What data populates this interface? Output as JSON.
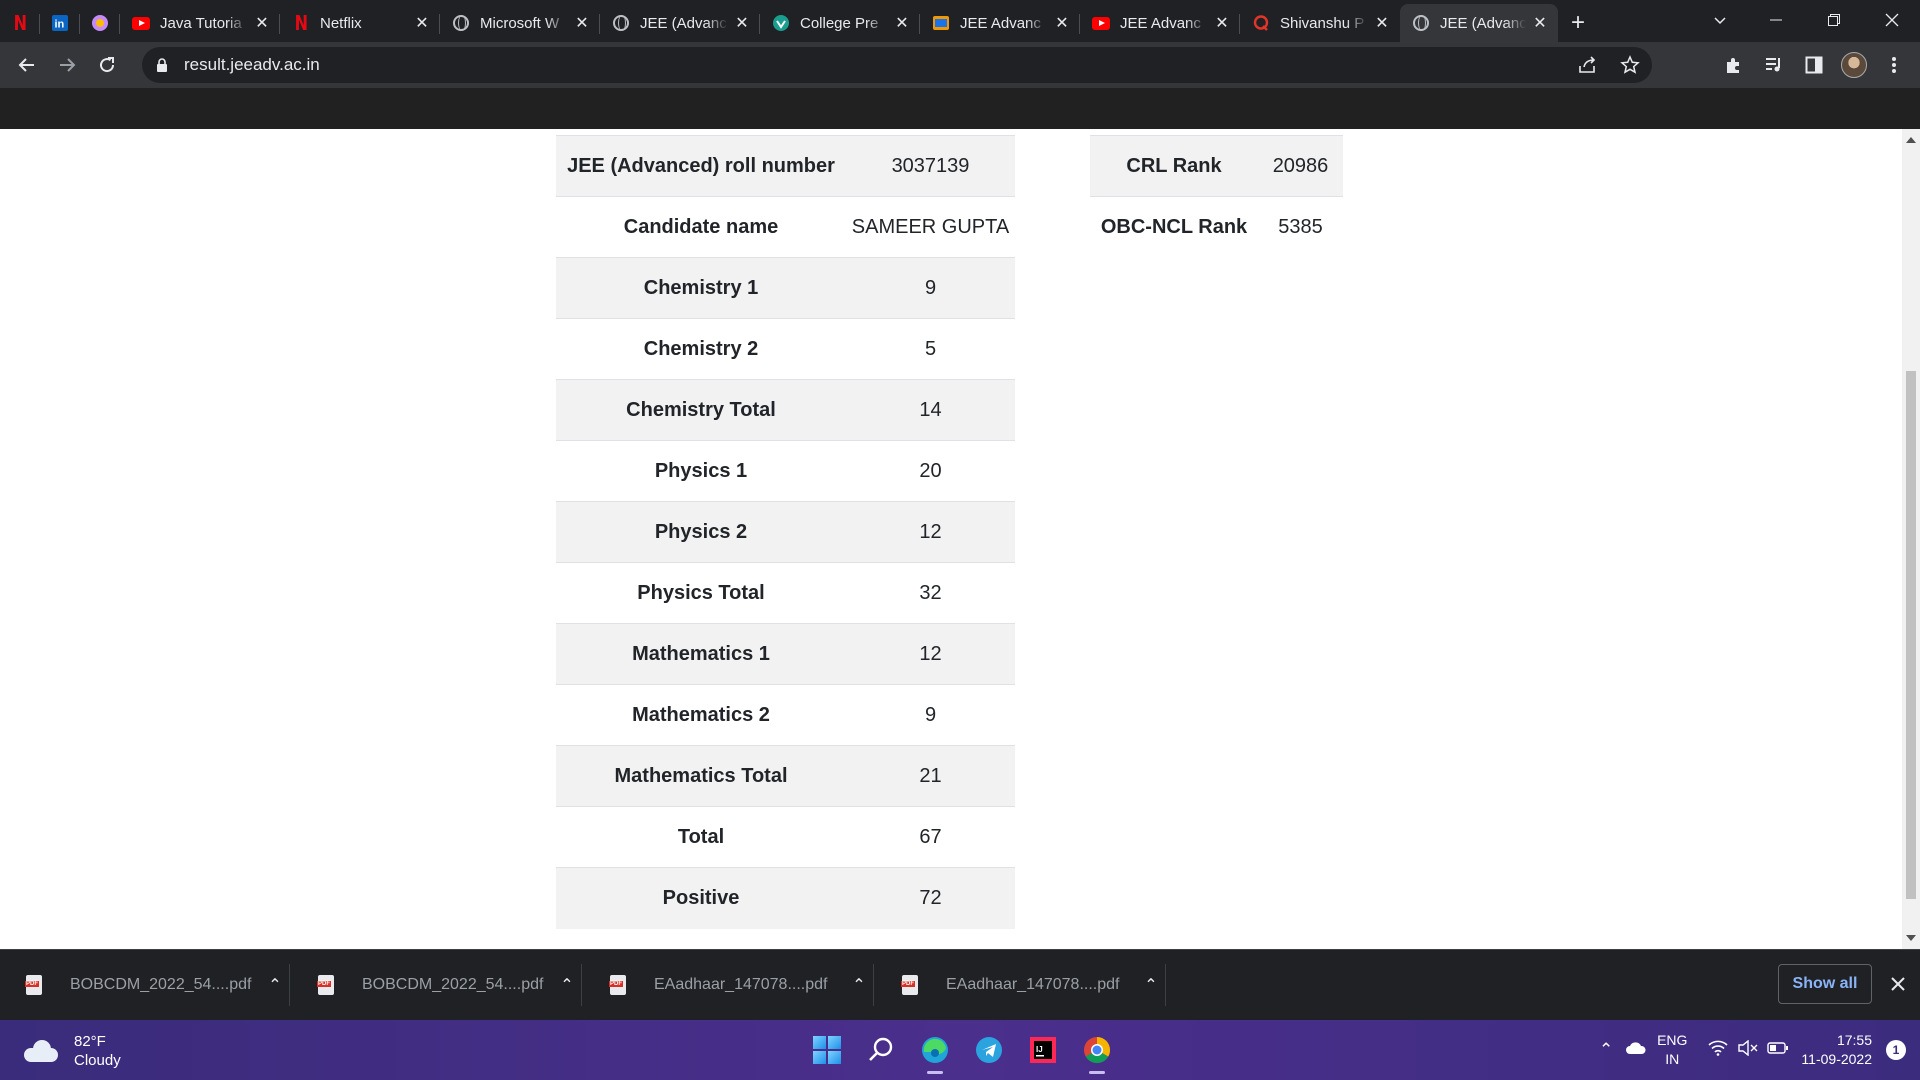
{
  "browser": {
    "tabs": [
      {
        "title": "",
        "icon": "netflix-icon",
        "pinned": true
      },
      {
        "title": "",
        "icon": "linkedin-icon",
        "pinned": true
      },
      {
        "title": "",
        "icon": "app-icon",
        "pinned": true
      },
      {
        "title": "Java Tutoria",
        "icon": "youtube-icon"
      },
      {
        "title": "Netflix",
        "icon": "netflix-icon"
      },
      {
        "title": "Microsoft W",
        "icon": "globe-icon"
      },
      {
        "title": "JEE (Advanc",
        "icon": "globe-icon"
      },
      {
        "title": "College Pre",
        "icon": "college-icon"
      },
      {
        "title": "JEE Advanc",
        "icon": "jee-icon"
      },
      {
        "title": "JEE Advanc",
        "icon": "youtube-icon"
      },
      {
        "title": "Shivanshu P",
        "icon": "quora-icon"
      },
      {
        "title": "JEE (Advanc",
        "icon": "globe-icon",
        "active": true
      }
    ],
    "url": "result.jeeadv.ac.in"
  },
  "results": {
    "rows": [
      {
        "label": "JEE (Advanced) roll number",
        "value": "3037139"
      },
      {
        "label": "Candidate name",
        "value": "SAMEER GUPTA"
      },
      {
        "label": "Chemistry 1",
        "value": "9"
      },
      {
        "label": "Chemistry 2",
        "value": "5"
      },
      {
        "label": "Chemistry Total",
        "value": "14"
      },
      {
        "label": "Physics 1",
        "value": "20"
      },
      {
        "label": "Physics 2",
        "value": "12"
      },
      {
        "label": "Physics Total",
        "value": "32"
      },
      {
        "label": "Mathematics 1",
        "value": "12"
      },
      {
        "label": "Mathematics 2",
        "value": "9"
      },
      {
        "label": "Mathematics Total",
        "value": "21"
      },
      {
        "label": "Total",
        "value": "67"
      },
      {
        "label": "Positive",
        "value": "72"
      }
    ],
    "ranks": [
      {
        "label": "CRL Rank",
        "value": "20986"
      },
      {
        "label": "OBC-NCL Rank",
        "value": "5385"
      }
    ]
  },
  "downloads": {
    "items": [
      {
        "name": "BOBCDM_2022_54....pdf"
      },
      {
        "name": "BOBCDM_2022_54....pdf"
      },
      {
        "name": "EAadhaar_147078....pdf"
      },
      {
        "name": "EAadhaar_147078....pdf"
      }
    ],
    "show_all": "Show all"
  },
  "taskbar": {
    "weather_temp": "82°F",
    "weather_desc": "Cloudy",
    "lang_top": "ENG",
    "lang_bottom": "IN",
    "time": "17:55",
    "date": "11-09-2022",
    "notifications": "1"
  }
}
